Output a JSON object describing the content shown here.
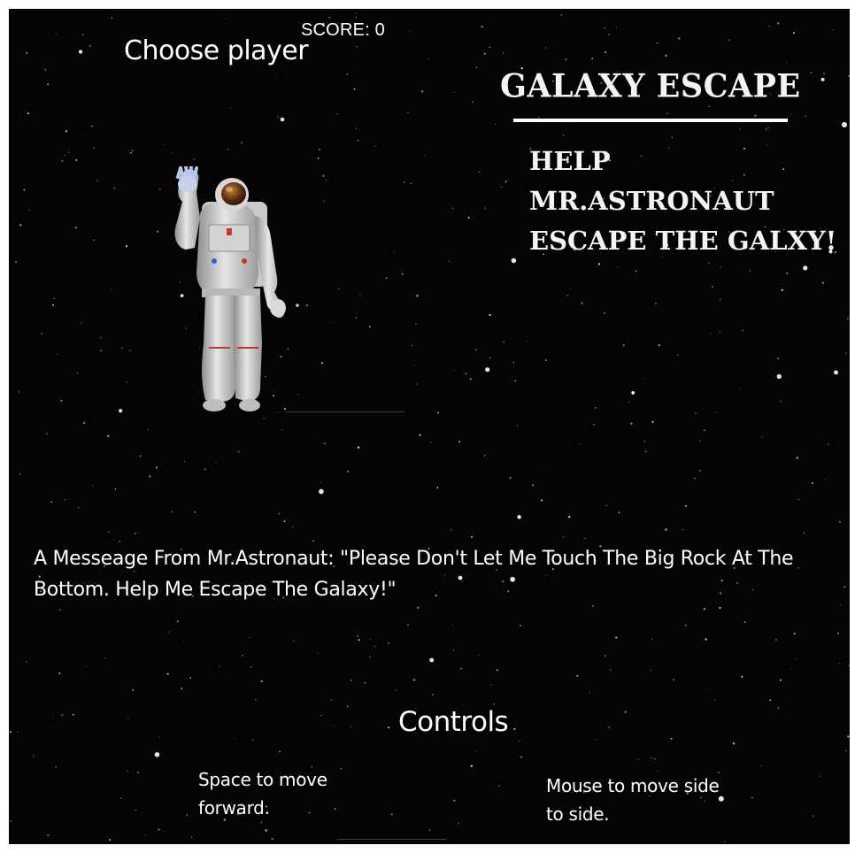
{
  "hud": {
    "score_text": "SCORE: 0"
  },
  "menu": {
    "choose_player": "Choose player",
    "title": "GALAXY ESCAPE",
    "tagline": [
      "HELP",
      "MR.ASTRONAUT",
      "ESCAPE THE GALXY!"
    ]
  },
  "player": {
    "character": "astronaut"
  },
  "message": {
    "text": "A Messeage From Mr.Astronaut: \"Please Don't Let Me Touch The Big Rock At The Bottom. Help Me Escape The Galaxy!\""
  },
  "controls": {
    "heading": "Controls",
    "space": "Space to move forward.",
    "mouse": "Mouse to move side to side."
  },
  "colors": {
    "background": "#050303",
    "text": "#ffffff"
  }
}
